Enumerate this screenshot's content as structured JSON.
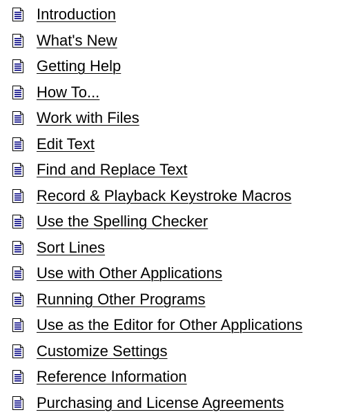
{
  "toc": {
    "items": [
      {
        "label": "Introduction",
        "icon": "document-page-icon"
      },
      {
        "label": "What's New",
        "icon": "document-page-icon"
      },
      {
        "label": "Getting Help",
        "icon": "document-page-icon"
      },
      {
        "label": "How To...",
        "icon": "document-page-icon"
      },
      {
        "label": "Work with Files",
        "icon": "document-page-icon"
      },
      {
        "label": "Edit Text",
        "icon": "document-page-icon"
      },
      {
        "label": "Find and Replace Text",
        "icon": "document-page-icon"
      },
      {
        "label": "Record & Playback Keystroke Macros",
        "icon": "document-page-icon"
      },
      {
        "label": "Use the Spelling Checker",
        "icon": "document-page-icon"
      },
      {
        "label": "Sort Lines",
        "icon": "document-page-icon"
      },
      {
        "label": "Use with Other Applications",
        "icon": "document-page-icon"
      },
      {
        "label": "Running Other Programs",
        "icon": "document-page-icon"
      },
      {
        "label": "Use as the Editor for Other Applications",
        "icon": "document-page-icon"
      },
      {
        "label": "Customize Settings",
        "icon": "document-page-icon"
      },
      {
        "label": "Reference Information",
        "icon": "document-page-icon"
      },
      {
        "label": "Purchasing and License Agreements",
        "icon": "document-page-icon"
      }
    ]
  },
  "colors": {
    "link_text": "#000000",
    "background": "#ffffff",
    "icon_page": "#ffffff",
    "icon_fold": "#c0c0c0",
    "icon_lines": "#000080",
    "icon_border": "#000000"
  }
}
